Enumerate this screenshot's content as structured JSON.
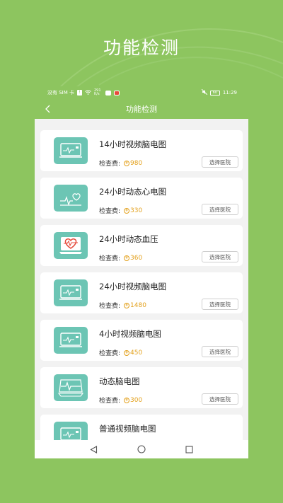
{
  "promo": {
    "title": "功能检测"
  },
  "status_bar": {
    "carrier": "没有 SIM 卡",
    "speed": "291 K/s",
    "time": "11:29",
    "battery": "60"
  },
  "nav": {
    "title": "功能检测"
  },
  "price_label": "检查费:",
  "hospital_button": "选择医院",
  "items": [
    {
      "title": "14小时视频脑电图",
      "price": "980",
      "icon": "video-eeg-icon"
    },
    {
      "title": "24小时动态心电图",
      "price": "330",
      "icon": "heart-ecg-icon"
    },
    {
      "title": "24小时动态血压",
      "price": "360",
      "icon": "blood-pressure-icon"
    },
    {
      "title": "24小时视频脑电图",
      "price": "1480",
      "icon": "video-eeg-icon"
    },
    {
      "title": "4小时视频脑电图",
      "price": "450",
      "icon": "video-eeg-icon"
    },
    {
      "title": "动态脑电图",
      "price": "300",
      "icon": "ambulatory-eeg-icon"
    },
    {
      "title": "普通视频脑电图",
      "price": "",
      "icon": "video-eeg-icon"
    }
  ],
  "colors": {
    "brand_green": "#8dc55f",
    "icon_teal": "#6cc5b4",
    "price_orange": "#e3a11d"
  }
}
